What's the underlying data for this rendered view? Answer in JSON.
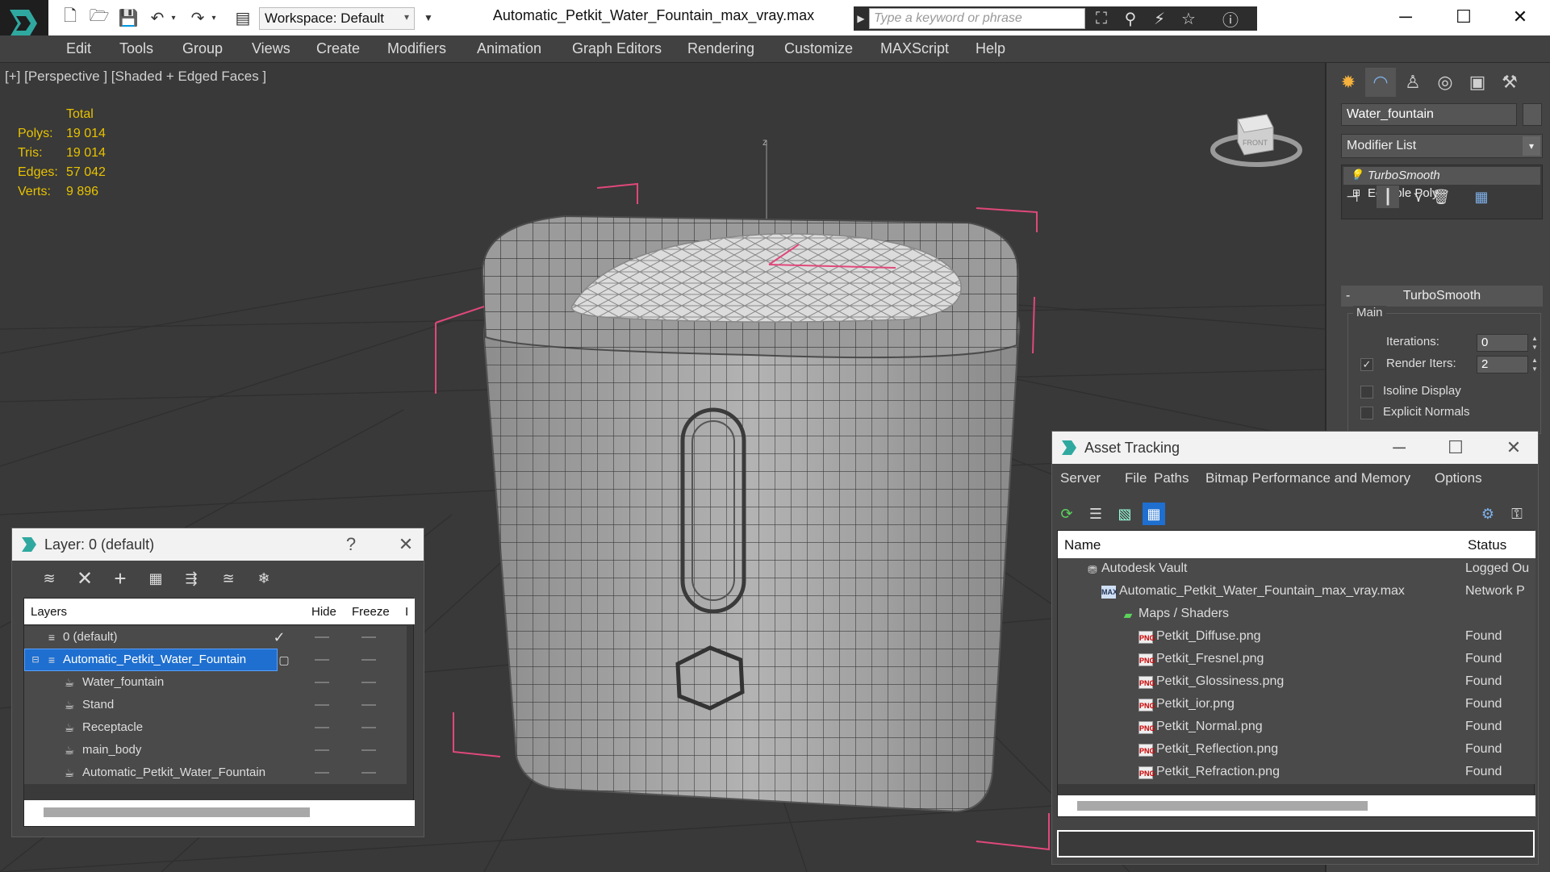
{
  "titlebar": {
    "workspace": "Workspace: Default",
    "file_title": "Automatic_Petkit_Water_Fountain_max_vray.max",
    "search_placeholder": "Type a keyword or phrase"
  },
  "menu": [
    "Edit",
    "Tools",
    "Group",
    "Views",
    "Create",
    "Modifiers",
    "Animation",
    "Graph Editors",
    "Rendering",
    "Customize",
    "MAXScript",
    "Help"
  ],
  "viewport": {
    "label": "[+] [Perspective ] [Shaded + Edged Faces ]",
    "stats": {
      "header": "Total",
      "polys_label": "Polys:",
      "polys": "19 014",
      "tris_label": "Tris:",
      "tris": "19 014",
      "edges_label": "Edges:",
      "edges": "57 042",
      "verts_label": "Verts:",
      "verts": "9 896"
    },
    "axis_label": "z",
    "viewcube_label": "FRONT"
  },
  "command_panel": {
    "object_name": "Water_fountain",
    "modifier_list": "Modifier List",
    "stack": [
      "TurboSmooth",
      "Editable Poly"
    ],
    "rollout_title": "TurboSmooth",
    "group_main": "Main",
    "iterations_label": "Iterations:",
    "iterations": "0",
    "render_iters_label": "Render Iters:",
    "render_iters": "2",
    "isoline_label": "Isoline Display",
    "explicit_normals_label": "Explicit Normals"
  },
  "layer_window": {
    "title": "Layer: 0 (default)",
    "help": "?",
    "columns": {
      "layers": "Layers",
      "hide": "Hide",
      "freeze": "Freeze",
      "extra": "I"
    },
    "rows": [
      {
        "name": "0 (default)"
      },
      {
        "name": "Automatic_Petkit_Water_Fountain"
      },
      {
        "name": "Water_fountain"
      },
      {
        "name": "Stand"
      },
      {
        "name": "Receptacle"
      },
      {
        "name": "main_body"
      },
      {
        "name": "Automatic_Petkit_Water_Fountain"
      }
    ]
  },
  "asset_window": {
    "title": "Asset Tracking",
    "menu": [
      "Server",
      "File",
      "Paths",
      "Bitmap Performance and Memory",
      "Options"
    ],
    "columns": {
      "name": "Name",
      "status": "Status"
    },
    "rows": [
      {
        "name": "Autodesk Vault",
        "status": "Logged Ou"
      },
      {
        "name": "Automatic_Petkit_Water_Fountain_max_vray.max",
        "status": "Network P"
      },
      {
        "name": "Maps / Shaders",
        "status": ""
      },
      {
        "name": "Petkit_Diffuse.png",
        "status": "Found"
      },
      {
        "name": "Petkit_Fresnel.png",
        "status": "Found"
      },
      {
        "name": "Petkit_Glossiness.png",
        "status": "Found"
      },
      {
        "name": "Petkit_ior.png",
        "status": "Found"
      },
      {
        "name": "Petkit_Normal.png",
        "status": "Found"
      },
      {
        "name": "Petkit_Reflection.png",
        "status": "Found"
      },
      {
        "name": "Petkit_Refraction.png",
        "status": "Found"
      }
    ],
    "png_badge": "PNG",
    "max_badge": "MAX"
  },
  "colors": {
    "stats": "#e8c200",
    "selection": "#1e6fd0",
    "bbox": "#e0487a"
  }
}
